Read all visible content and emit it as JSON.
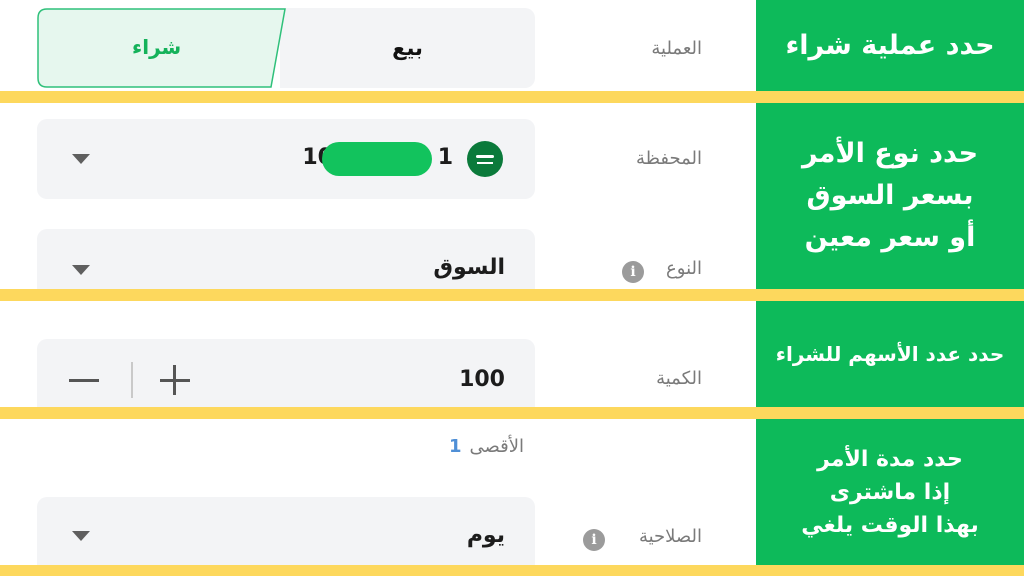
{
  "annotations": {
    "step1": "حدد عملية شراء",
    "step2": "حدد نوع الأمر\nبسعر السوق\nأو سعر معين",
    "step3": "حدد عدد الأسهم للشراء",
    "step4": "حدد مدة الأمر\nإذا ماشترى\nبهذا الوقت يلغي"
  },
  "operation": {
    "label": "العملية",
    "sell_label": "بيع",
    "buy_label": "شراء",
    "selected": "buy"
  },
  "portfolio": {
    "label": "المحفظة",
    "value_prefix": "10",
    "value_suffix": "1",
    "flag_icon": "saudi-flag-icon"
  },
  "order_type": {
    "label": "النوع",
    "value": "السوق",
    "info_icon": "i"
  },
  "quantity": {
    "label": "الكمية",
    "value": "100",
    "max_label": "الأقصى",
    "max_value": "1"
  },
  "validity": {
    "label": "الصلاحية",
    "value": "يوم",
    "info_icon": "i"
  },
  "colors": {
    "annotation_green": "#0dba5a",
    "separator_yellow": "#fdd85d",
    "buy_green": "#14b25a",
    "field_bg": "#f3f4f6"
  }
}
